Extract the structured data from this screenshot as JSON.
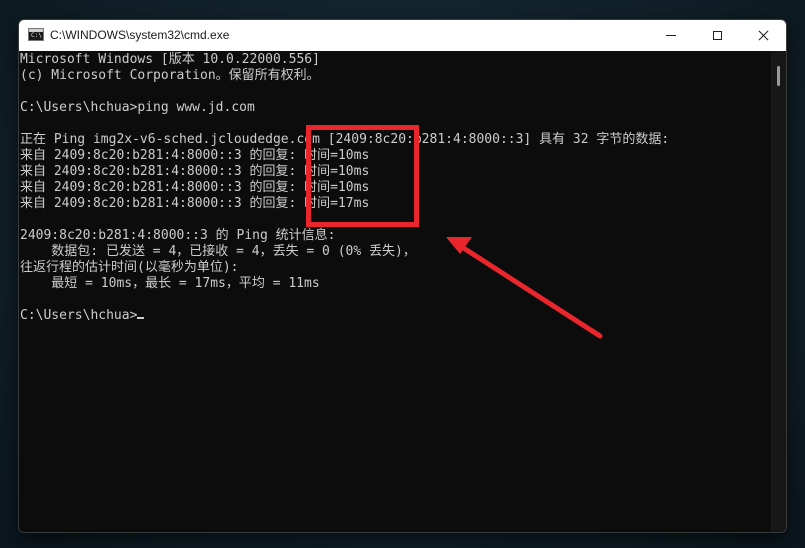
{
  "window": {
    "title": "C:\\WINDOWS\\system32\\cmd.exe",
    "icon_text": "C:\\",
    "controls": {
      "minimize_icon": "minimize-icon",
      "maximize_icon": "maximize-icon",
      "close_icon": "close-icon"
    }
  },
  "console": {
    "lines": [
      "Microsoft Windows [版本 10.0.22000.556]",
      "(c) Microsoft Corporation。保留所有权利。",
      "",
      "C:\\Users\\hchua>ping www.jd.com",
      "",
      "正在 Ping img2x-v6-sched.jcloudedge.com [2409:8c20:b281:4:8000::3] 具有 32 字节的数据:",
      "来自 2409:8c20:b281:4:8000::3 的回复: 时间=10ms",
      "来自 2409:8c20:b281:4:8000::3 的回复: 时间=10ms",
      "来自 2409:8c20:b281:4:8000::3 的回复: 时间=10ms",
      "来自 2409:8c20:b281:4:8000::3 的回复: 时间=17ms",
      "",
      "2409:8c20:b281:4:8000::3 的 Ping 统计信息:",
      "    数据包: 已发送 = 4，已接收 = 4，丢失 = 0 (0% 丢失)，",
      "往返行程的估计时间(以毫秒为单位):",
      "    最短 = 10ms，最长 = 17ms，平均 = 11ms",
      "",
      "C:\\Users\\hchua>"
    ]
  },
  "annotation": {
    "highlight_color": "#e8262b",
    "arrow_color": "#e8262b"
  },
  "colors": {
    "console_background": "#0c0c0c",
    "console_text": "#cccccc",
    "titlebar_background": "#ffffff"
  }
}
